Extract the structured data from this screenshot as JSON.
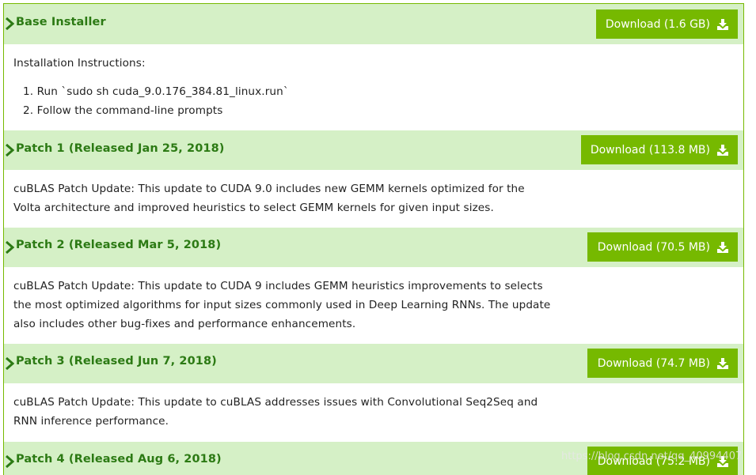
{
  "sections": [
    {
      "title": "Base Installer",
      "download_label": "Download (1.6 GB)",
      "instructions_heading": "Installation Instructions:",
      "steps": [
        "1. Run `sudo sh cuda_9.0.176_384.81_linux.run`",
        "2. Follow the command-line prompts"
      ]
    },
    {
      "title": "Patch 1 (Released Jan 25, 2018)",
      "download_label": "Download (113.8 MB)",
      "lines": [
        "cuBLAS Patch Update: This update to CUDA 9.0 includes new GEMM kernels optimized for the",
        "Volta architecture and improved heuristics to select GEMM kernels for given input sizes."
      ]
    },
    {
      "title": "Patch 2 (Released Mar 5, 2018)",
      "download_label": "Download (70.5 MB)",
      "lines": [
        "cuBLAS Patch Update: This update to CUDA 9 includes GEMM heuristics improvements to selects",
        "the most optimized algorithms for input sizes commonly used in Deep Learning RNNs. The update",
        "also includes other bug-fixes and performance enhancements."
      ]
    },
    {
      "title": "Patch 3 (Released Jun 7, 2018)",
      "download_label": "Download (74.7 MB)",
      "lines": [
        "cuBLAS Patch Update: This update to cuBLAS addresses issues with Convolutional Seq2Seq and",
        "RNN inference performance."
      ]
    },
    {
      "title": "Patch 4 (Released Aug 6, 2018)",
      "download_label": "Download (75.2 MB)"
    }
  ],
  "watermark": "https://blog.csdn.net/qq_40994407",
  "colors": {
    "accent": "#76b900",
    "header_bg": "#d5f0c6",
    "title_text": "#2c7a14",
    "button_text": "#ffffff"
  },
  "icons": {
    "expand": "chevron-right-icon",
    "download": "download-icon"
  }
}
